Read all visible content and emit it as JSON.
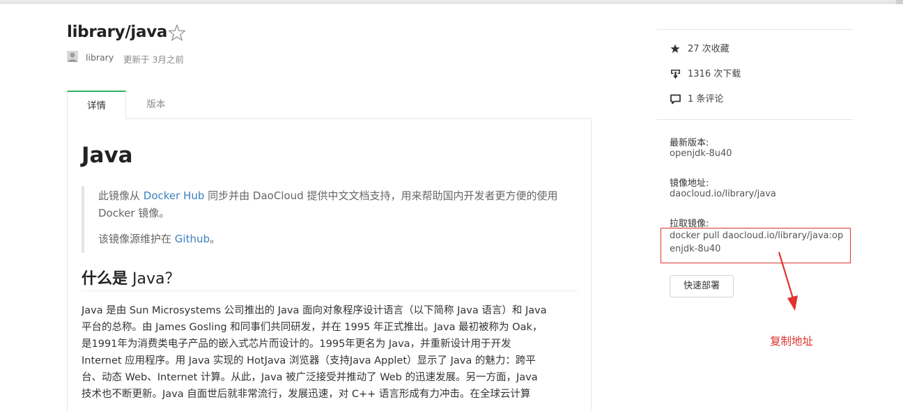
{
  "header": {
    "title": "library/java",
    "owner": "library",
    "updated": "更新于 3月之前"
  },
  "tabs": [
    {
      "label": "详情",
      "active": true
    },
    {
      "label": "版本",
      "active": false
    }
  ],
  "content": {
    "h1": "Java",
    "quote_p1_pre": "此镜像从 ",
    "quote_p1_link": "Docker Hub",
    "quote_p1_post": " 同步并由 DaoCloud 提供中文文档支持，用来帮助国内开发者更方便的使用 Docker 镜像。",
    "quote_p2_pre": "该镜像源维护在 ",
    "quote_p2_link": "Github",
    "quote_p2_post": "。",
    "h2_cn": "什么是",
    "h2_en": " Java？",
    "para_lines": [
      "Java 是由 Sun Microsystems 公司推出的 Java 面向对象程序设计语言（以下简称 Java 语言）和 Java",
      "平台的总称。由 James Gosling 和同事们共同研发，并在 1995 年正式推出。Java 最初被称为 Oak，",
      "是1991年为消费类电子产品的嵌入式芯片而设计的。1995年更名为 Java，并重新设计用于开发",
      "Internet 应用程序。用 Java 实现的 HotJava 浏览器（支持Java Applet）显示了 Java 的魅力：跨平",
      "台、动态 Web、Internet 计算。从此，Java 被广泛接受并推动了 Web 的迅速发展。另一方面，Java",
      "技术也不断更新。Java 自面世后就非常流行，发展迅速，对 C++ 语言形成有力冲击。在全球云计算"
    ]
  },
  "sidebar": {
    "stats": [
      {
        "icon": "star-filled-icon",
        "text": "27 次收藏"
      },
      {
        "icon": "download-icon",
        "text": "1316 次下载"
      },
      {
        "icon": "comment-icon",
        "text": "1 条评论"
      }
    ],
    "latest_label": "最新版本:",
    "latest_value": "openjdk-8u40",
    "address_label": "镜像地址:",
    "address_value": "daocloud.io/library/java",
    "pull_label": "拉取镜像:",
    "pull_value": "docker pull daocloud.io/library/java:openjdk-8u40",
    "deploy_button": "快速部署"
  },
  "annotation": {
    "text": "复制地址",
    "color": "#e0332d"
  },
  "colors": {
    "accent": "#2fb264",
    "link": "#3c7fc0",
    "annotation": "#d9342b"
  }
}
